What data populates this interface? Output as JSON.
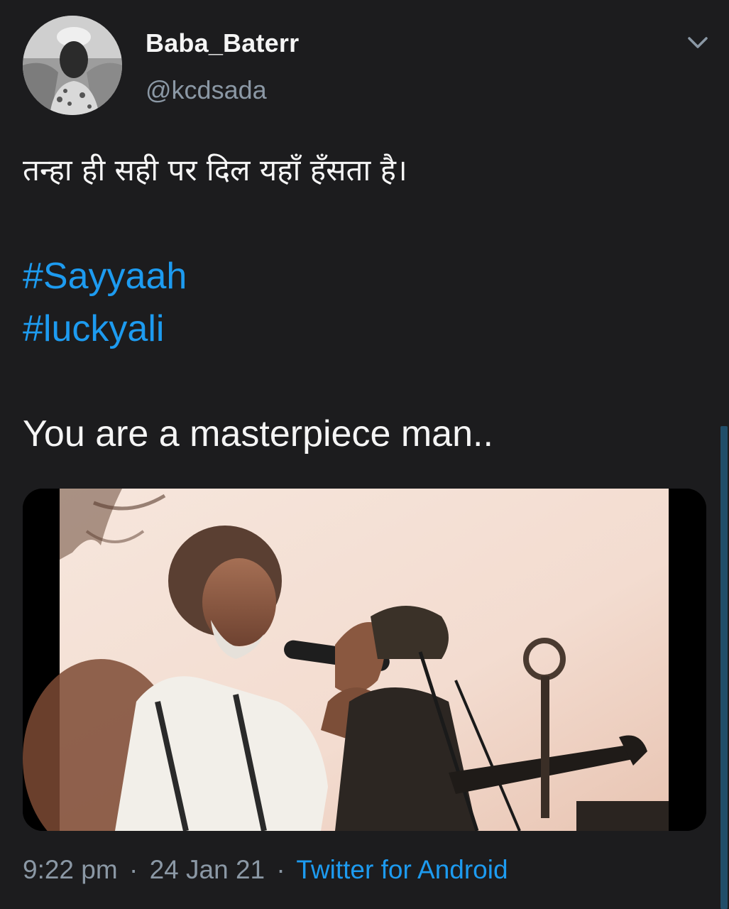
{
  "tweet": {
    "display_name": "Baba_Baterr",
    "handle": "@kcdsada",
    "text_hindi": "तन्हा ही सही पर दिल यहाँ हँसता है।",
    "hashtags": [
      "#Sayyaah",
      "#luckyali"
    ],
    "text_english": "You are a masterpiece man..",
    "time": "9:22 pm",
    "separator": "·",
    "date": "24 Jan 21",
    "source": "Twitter for Android"
  },
  "icons": {
    "menu": "chevron-down-icon",
    "avatar": "avatar"
  },
  "colors": {
    "background": "#1c1c1e",
    "text": "#f5f5f5",
    "secondary": "#8b98a5",
    "link": "#1d9bf0",
    "scrollbar": "#214e69"
  }
}
